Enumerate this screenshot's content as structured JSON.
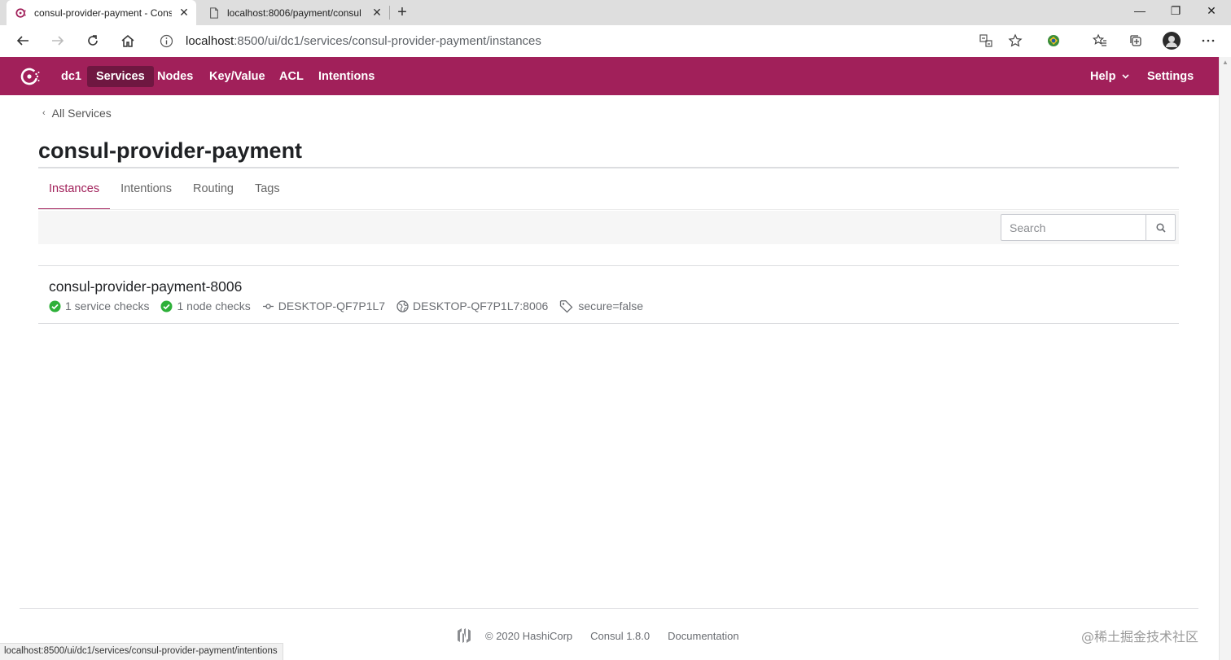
{
  "browser": {
    "tabs": [
      {
        "title": "consul-provider-payment - Consul",
        "active": true
      },
      {
        "title": "localhost:8006/payment/consul",
        "active": false
      }
    ],
    "url_host": "localhost",
    "url_rest": ":8500/ui/dc1/services/consul-provider-payment/instances",
    "status_url": "localhost:8500/ui/dc1/services/consul-provider-payment/intentions"
  },
  "nav": {
    "datacenter": "dc1",
    "items": [
      "Services",
      "Nodes",
      "Key/Value",
      "ACL",
      "Intentions"
    ],
    "selected": "Services",
    "help": "Help",
    "settings": "Settings"
  },
  "breadcrumb": "All Services",
  "service": {
    "name": "consul-provider-payment",
    "tabs": [
      "Instances",
      "Intentions",
      "Routing",
      "Tags"
    ],
    "active_tab": "Instances"
  },
  "search": {
    "placeholder": "Search"
  },
  "instances": [
    {
      "name": "consul-provider-payment-8006",
      "service_checks": "1 service checks",
      "node_checks": "1 node checks",
      "node": "DESKTOP-QF7P1L7",
      "address": "DESKTOP-QF7P1L7:8006",
      "tags": "secure=false"
    }
  ],
  "footer": {
    "copyright": "© 2020 HashiCorp",
    "version": "Consul 1.8.0",
    "docs": "Documentation"
  },
  "watermark": "@稀土掘金技术社区",
  "colors": {
    "brand": "#a1205a",
    "brand_dark": "#6f1741",
    "passing": "#2eb039"
  }
}
